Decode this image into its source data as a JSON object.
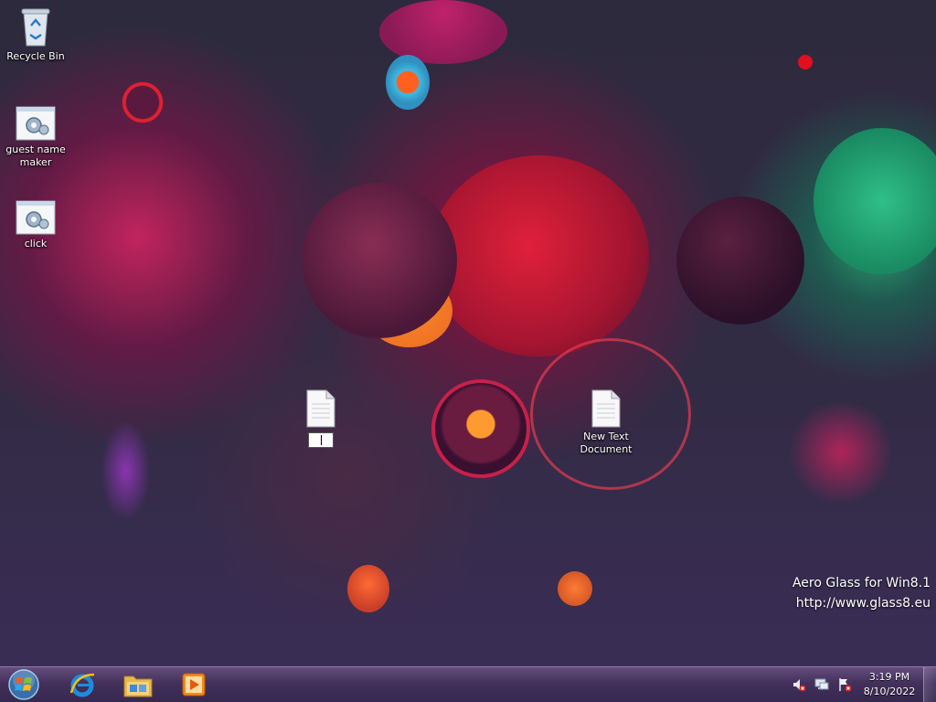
{
  "desktop": {
    "icons": [
      {
        "label": "Recycle Bin",
        "icon": "recycle-bin-icon"
      },
      {
        "label": "guest name maker",
        "icon": "exe-gear-icon"
      },
      {
        "label": "click",
        "icon": "exe-gear-icon"
      },
      {
        "label": "",
        "icon": "text-file-icon",
        "renaming": true
      },
      {
        "label": "New Text Document",
        "icon": "text-file-icon"
      }
    ]
  },
  "watermark": {
    "line1": "Aero Glass for Win8.1",
    "line2": "http://www.glass8.eu"
  },
  "taskbar": {
    "pinned": [
      {
        "name": "start-button",
        "icon": "windows-orb-icon"
      },
      {
        "name": "internet-explorer",
        "icon": "ie-icon"
      },
      {
        "name": "file-explorer",
        "icon": "folder-icon"
      },
      {
        "name": "media-player",
        "icon": "media-player-icon"
      }
    ],
    "tray": [
      {
        "icon": "volume-muted-icon"
      },
      {
        "icon": "network-icon"
      },
      {
        "icon": "action-center-flag-icon"
      }
    ],
    "clock": {
      "time": "3:19 PM",
      "date": "8/10/2022"
    }
  },
  "colors": {
    "accent": "#c2245d",
    "taskbar": "#4b3568",
    "teal": "#2aa36f"
  }
}
